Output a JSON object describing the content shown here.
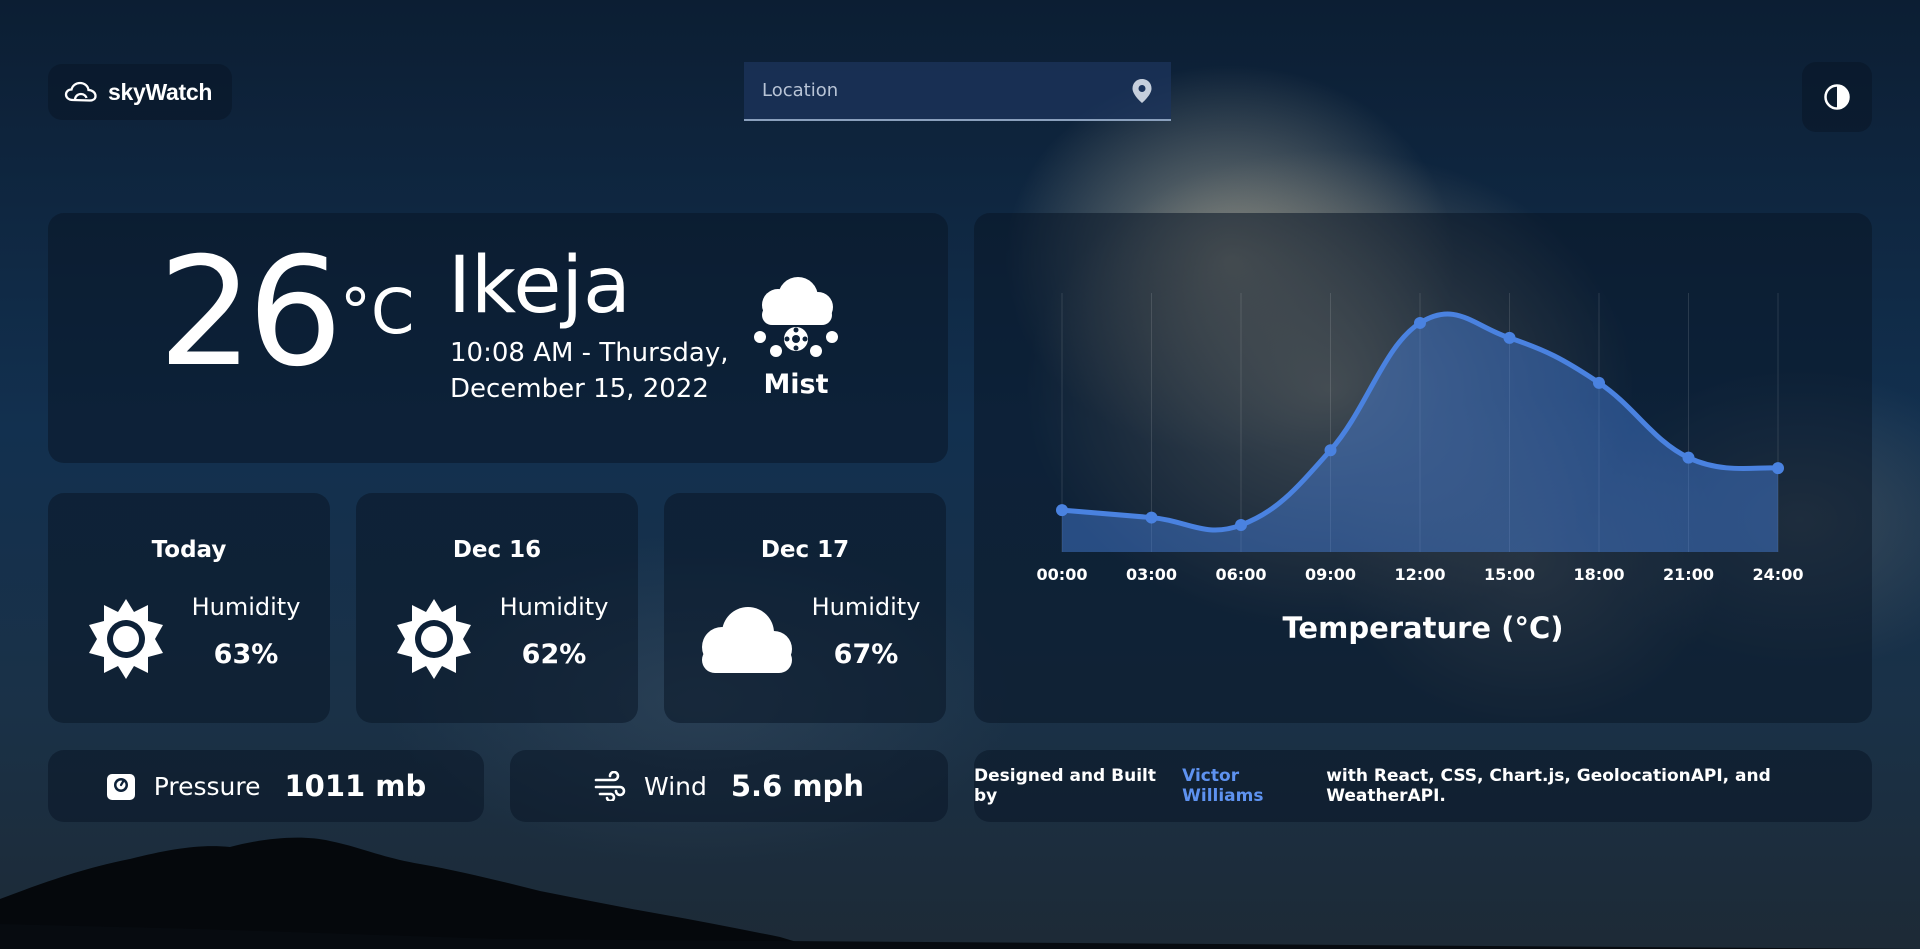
{
  "app": {
    "name": "skyWatch"
  },
  "search": {
    "placeholder": "Location"
  },
  "current": {
    "temperature": "26",
    "unit": "°C",
    "city": "Ikeja",
    "datetime": "10:08 AM - Thursday, December 15, 2022",
    "condition": "Mist",
    "icon": "snow-cloud-icon"
  },
  "forecast": [
    {
      "day": "Today",
      "icon": "sun-icon",
      "humidity_label": "Humidity",
      "humidity": "63%"
    },
    {
      "day": "Dec 16",
      "icon": "sun-icon",
      "humidity_label": "Humidity",
      "humidity": "62%"
    },
    {
      "day": "Dec 17",
      "icon": "cloud-icon",
      "humidity_label": "Humidity",
      "humidity": "67%"
    }
  ],
  "stats": {
    "pressure": {
      "label": "Pressure",
      "value": "1011 mb",
      "icon": "gauge-icon"
    },
    "wind": {
      "label": "Wind",
      "value": "5.6 mph",
      "icon": "wind-icon"
    }
  },
  "credit": {
    "prefix": "Designed and Built by",
    "author": "Victor Williams",
    "suffix": "with React, CSS, Chart.js, GeolocationAPI, and WeatherAPI."
  },
  "colors": {
    "accent": "#4a82e0",
    "link": "#5e92f0"
  },
  "chart_data": {
    "type": "area",
    "title": "Temperature (°C)",
    "x": [
      "00:00",
      "03:00",
      "06:00",
      "09:00",
      "12:00",
      "15:00",
      "18:00",
      "21:00",
      "24:00"
    ],
    "series": [
      {
        "values": [
          23,
          22.5,
          22,
          27,
          35.5,
          34.5,
          31.5,
          26.5,
          25.8
        ]
      }
    ],
    "ylim": [
      20.2,
      37.5
    ],
    "grid": "vertical",
    "color": "#4a82e0"
  }
}
